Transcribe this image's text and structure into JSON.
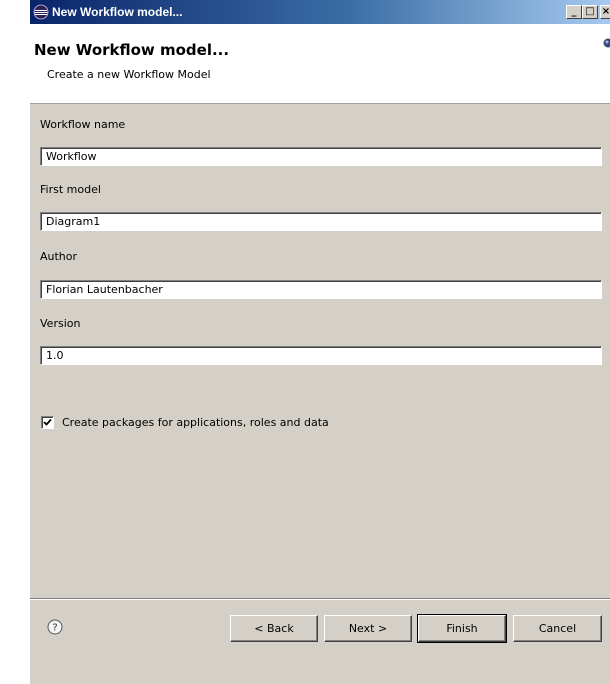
{
  "window": {
    "title": "New Workflow model...",
    "minimize_glyph": "_",
    "maximize_glyph": "□",
    "close_glyph": "×",
    "title_icon": "eclipse-icon"
  },
  "banner": {
    "title": "New Workflow model...",
    "description": "Create a new Workflow Model",
    "icon": "wizard-banner-icon"
  },
  "form": {
    "workflow_name_label": "Workflow name",
    "workflow_name_value": "Workflow",
    "first_model_label": "First model",
    "first_model_value": "Diagram1",
    "author_label": "Author",
    "author_value": "Florian Lautenbacher",
    "version_label": "Version",
    "version_value": "1.0",
    "create_packages_label": "Create packages for applications, roles and data",
    "create_packages_checked": true
  },
  "buttons": {
    "help_icon": "help-icon",
    "back": "< Back",
    "next": "Next >",
    "finish": "Finish",
    "cancel": "Cancel"
  },
  "colors": {
    "titlebar_start": "#0a246a",
    "titlebar_end": "#a6caf0",
    "dialog_bg": "#d4d0c8",
    "banner_bg": "#ffffff"
  }
}
